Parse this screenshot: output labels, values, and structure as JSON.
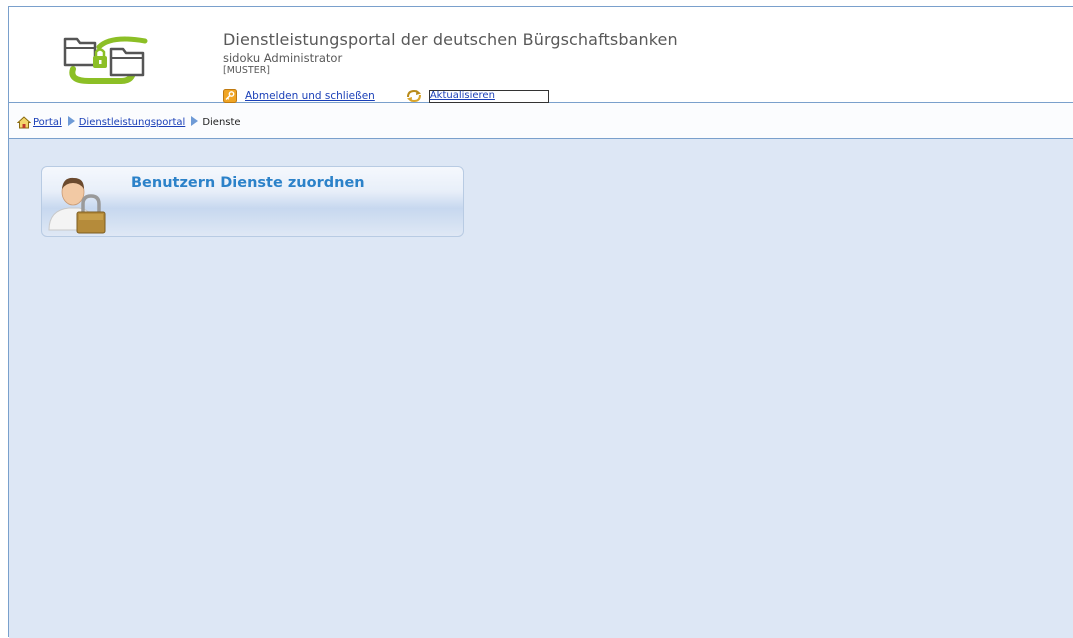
{
  "header": {
    "title": "Dienstleistungsportal der deutschen Bürgschaftsbanken",
    "user": "sidoku Administrator",
    "tenant": "[MUSTER]",
    "logout_label": "Abmelden und schließen",
    "refresh_label": "Aktualisieren"
  },
  "breadcrumb": {
    "items": [
      {
        "label": "Portal"
      },
      {
        "label": "Dienstleistungsportal"
      }
    ],
    "current": "Dienste"
  },
  "tiles": [
    {
      "label": "Benutzern Dienste zuordnen",
      "icon": "user-lock-icon"
    }
  ],
  "colors": {
    "logo_green": "#8cbf26",
    "link": "#1a3fb7",
    "tile_title": "#2c82c9",
    "content_bg": "#dde7f5",
    "border": "#7aa0cc"
  }
}
